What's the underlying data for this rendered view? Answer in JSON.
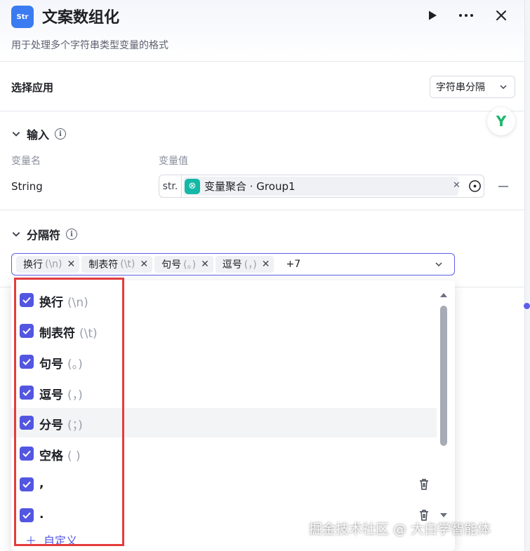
{
  "header": {
    "app_icon_text": "Str",
    "title": "文案数组化",
    "subtitle": "用于处理多个字符串类型变量的格式"
  },
  "select_app": {
    "label": "选择应用",
    "value": "字符串分隔"
  },
  "assistant_logo": "Y",
  "input_section": {
    "title": "输入",
    "col_name": "变量名",
    "col_value": "变量值",
    "row": {
      "name": "String",
      "type_tag": "str.",
      "chip_label": "变量聚合 · Group1"
    }
  },
  "separator_section": {
    "title": "分隔符",
    "tags": [
      {
        "label": "换行",
        "hint": "(\\n)"
      },
      {
        "label": "制表符",
        "hint": "(\\t)"
      },
      {
        "label": "句号",
        "hint": "(。)"
      },
      {
        "label": "逗号",
        "hint": "(，)"
      }
    ],
    "more": "+7"
  },
  "dropdown": {
    "options": [
      {
        "label": "换行",
        "hint": "(\\n)",
        "checked": true
      },
      {
        "label": "制表符",
        "hint": "(\\t)",
        "checked": true
      },
      {
        "label": "句号",
        "hint": "(。)",
        "checked": true
      },
      {
        "label": "逗号",
        "hint": "(，)",
        "checked": true
      },
      {
        "label": "分号",
        "hint": "(；)",
        "checked": true
      },
      {
        "label": "空格",
        "hint": "( )",
        "checked": true
      },
      {
        "label": ",",
        "hint": "",
        "checked": true
      },
      {
        "label": ".",
        "hint": "",
        "checked": true
      }
    ],
    "custom_label": "自定义"
  },
  "watermark": "掘金技术社区 @ 大白学智能体",
  "colors": {
    "accent": "#5356e0",
    "highlight_border": "#e53b3b",
    "app_icon_bg": "#3a7bf2",
    "chip_icon_bg": "#14b8a6"
  }
}
